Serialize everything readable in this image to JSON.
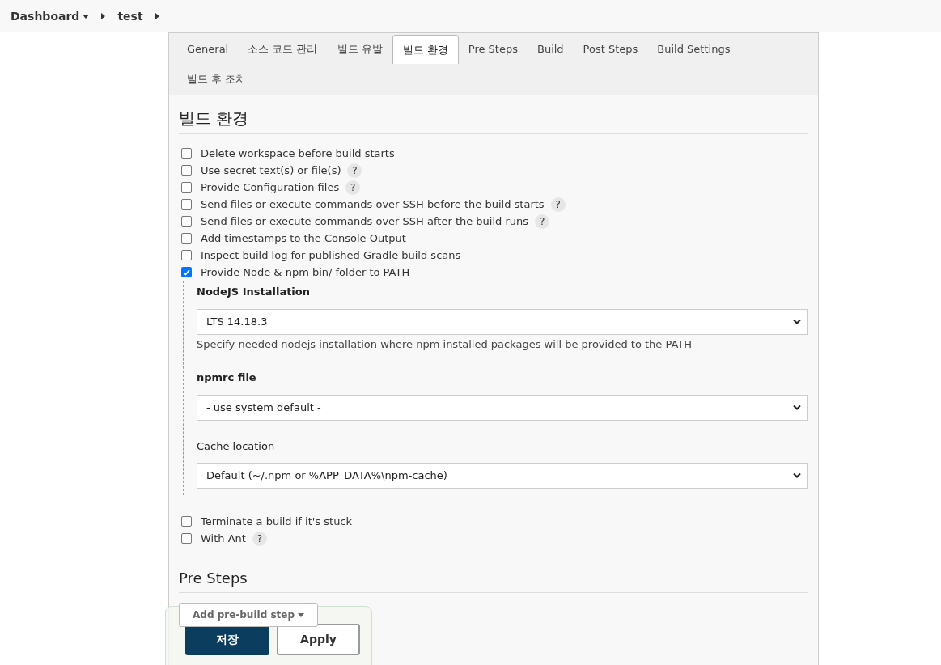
{
  "breadcrumbs": [
    {
      "label": "Dashboard",
      "dropdown": true
    },
    {
      "label": "test",
      "dropdown": false
    }
  ],
  "tabs": [
    {
      "label": "General",
      "selected": false
    },
    {
      "label": "소스 코드 관리",
      "selected": false
    },
    {
      "label": "빌드 유발",
      "selected": false
    },
    {
      "label": "빌드 환경",
      "selected": true
    },
    {
      "label": "Pre Steps",
      "selected": false
    },
    {
      "label": "Build",
      "selected": false
    },
    {
      "label": "Post Steps",
      "selected": false
    },
    {
      "label": "Build Settings",
      "selected": false
    },
    {
      "label": "빌드 후 조치",
      "selected": false
    }
  ],
  "section_title": "빌드 환경",
  "options": [
    {
      "label": "Delete workspace before build starts",
      "checked": false
    },
    {
      "label": "Use secret text(s) or file(s)",
      "checked": false,
      "help": "?"
    },
    {
      "label": "Provide Configuration files",
      "checked": false,
      "help": "?"
    },
    {
      "label": "Send files or execute commands over SSH before the build starts",
      "checked": false,
      "help": "?"
    },
    {
      "label": "Send files or execute commands over SSH after the build runs",
      "checked": false,
      "help": "?"
    },
    {
      "label": "Add timestamps to the Console Output",
      "checked": false
    },
    {
      "label": "Inspect build log for published Gradle build scans",
      "checked": false
    },
    {
      "label": "Provide Node & npm bin/ folder to PATH",
      "checked": true,
      "fields": [
        {
          "label": "NodeJS Installation",
          "bold": true,
          "value": "LTS 14.18.3",
          "description": "Specify needed nodejs installation where npm installed packages will be provided to the PATH"
        },
        {
          "label": "npmrc file",
          "bold": true,
          "value": "- use system default -"
        },
        {
          "label": "Cache location",
          "bold": false,
          "value": "Default (~/.npm or %APP_DATA%\\npm-cache)"
        }
      ]
    },
    {
      "label": "Terminate a build if it's stuck",
      "checked": false
    },
    {
      "label": "With Ant",
      "checked": false,
      "help": "?"
    }
  ],
  "pre_steps": {
    "title": "Pre Steps",
    "button": "Add pre-build step"
  },
  "footer": {
    "save": "저장",
    "apply": "Apply"
  }
}
